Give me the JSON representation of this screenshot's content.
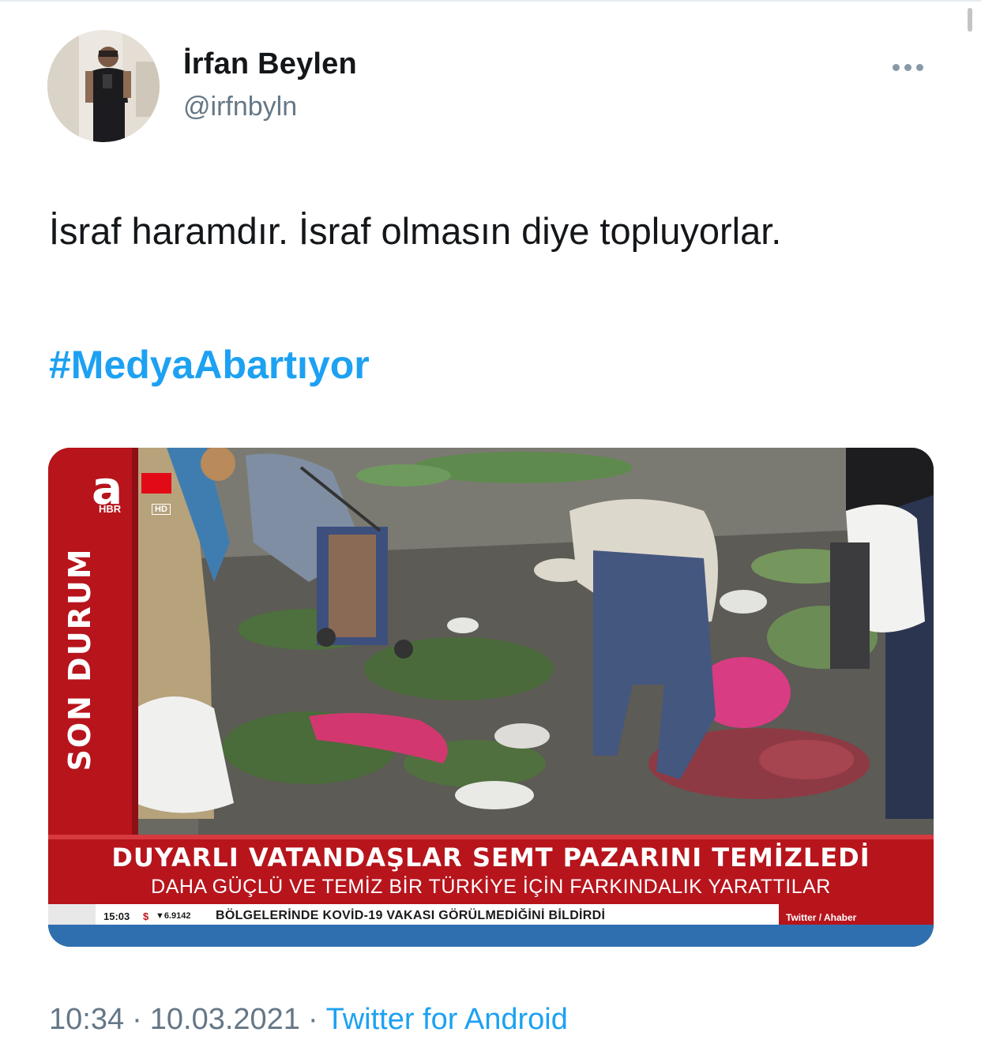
{
  "author": {
    "name": "İrfan Beylen",
    "handle": "@irfnbyln"
  },
  "tweet": {
    "text": "İsraf haramdır. İsraf olmasın diye topluyorlar.",
    "hashtag": "#MedyaAbartıyor"
  },
  "media": {
    "channel_logo": "a",
    "channel_sub": "HBR",
    "hd_badge": "HD",
    "side_label": "SON DURUM",
    "headline": "DUYARLI VATANDAŞLAR SEMT PAZARINI TEMİZLEDİ",
    "subheadline": "DAHA GÜÇLÜ VE TEMİZ BİR TÜRKİYE İÇİN FARKINDALIK YARATTILAR",
    "ticker_time": "15:03",
    "ticker_currency": "$",
    "ticker_rate": "▼6.9142",
    "ticker_text": "BÖLGELERİNDE KOVİD-19 VAKASI GÖRÜLMEDİĞİNİ BİLDİRDİ",
    "ticker_source": "Twitter / Ahaber"
  },
  "meta": {
    "time": "10:34",
    "date": "10.03.2021",
    "separator": "·",
    "client": "Twitter for Android"
  },
  "colors": {
    "link": "#1da1f2",
    "secondary_text": "#657786",
    "news_red": "#c0161d"
  }
}
